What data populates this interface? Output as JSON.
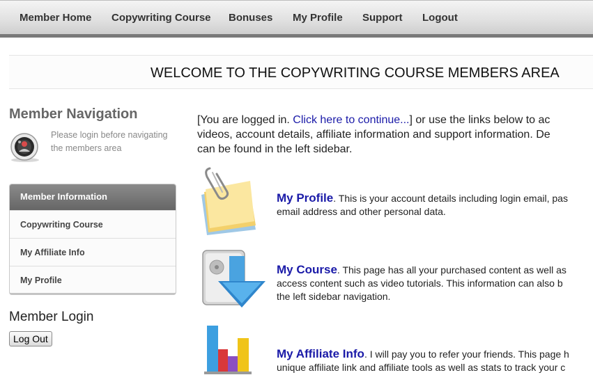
{
  "nav": {
    "items": [
      {
        "label": "Member Home"
      },
      {
        "label": "Copywriting Course"
      },
      {
        "label": "Bonuses"
      },
      {
        "label": "My Profile"
      },
      {
        "label": "Support"
      },
      {
        "label": "Logout"
      }
    ]
  },
  "banner": {
    "title": "WELCOME TO THE COPYWRITING COURSE MEMBERS AREA"
  },
  "sidebar": {
    "title": "Member Navigation",
    "note": "Please login before navigating the members area",
    "menu": {
      "header": "Member Information",
      "items": [
        {
          "label": "Copywriting Course"
        },
        {
          "label": "My Affiliate Info"
        },
        {
          "label": "My Profile"
        }
      ]
    },
    "login_title": "Member Login",
    "logout_button": "Log Out"
  },
  "intro": {
    "before_link": "[You are logged in. ",
    "link": "Click here to continue...",
    "after_link": "] or use the links below to ac",
    "line2": "videos, account details, affiliate information and support information. De",
    "line3": "can be found in the left sidebar."
  },
  "features": [
    {
      "icon": "notes-paperclip-icon",
      "title": "My Profile",
      "text_line1": ". This is your account details including login email, pas",
      "text_line2": "email address and other personal data."
    },
    {
      "icon": "download-drive-icon",
      "title": "My Course",
      "text_line1": ". This page has all your purchased content as well as",
      "text_line2": "access content such as video tutorials. This information can also b",
      "text_line3": "the left sidebar navigation."
    },
    {
      "icon": "bar-chart-icon",
      "title": "My Affiliate Info",
      "text_line1": ". I will pay you to refer your friends. This page h",
      "text_line2": "unique affiliate link and affiliate tools as well as stats to track your c"
    }
  ],
  "colors": {
    "link": "#1a1aa8",
    "menu_header": "#777777",
    "nav_bar": "#dddddd"
  }
}
